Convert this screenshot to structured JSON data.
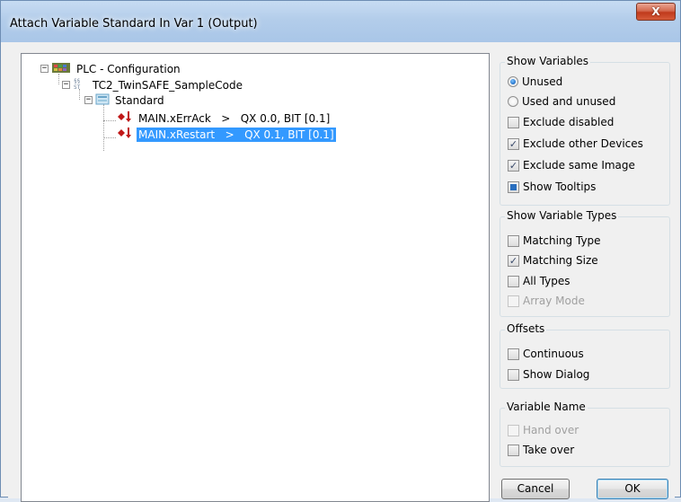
{
  "window": {
    "title": "Attach Variable Standard In Var 1 (Output)",
    "close_glyph": "X"
  },
  "tree": {
    "root": {
      "label": "PLC - Configuration",
      "icon": "plc-config-icon"
    },
    "project": {
      "label": "TC2_TwinSAFE_SampleCode",
      "icon": "plc-project-icon"
    },
    "folder": {
      "label": "Standard",
      "icon": "folder-icon"
    },
    "variables": [
      {
        "label": "MAIN.xErrAck   >   QX 0.0, BIT [0.1]",
        "icon": "output-variable-icon",
        "selected": false
      },
      {
        "label": "MAIN.xRestart   >   QX 0.1, BIT [0.1]",
        "icon": "output-variable-icon",
        "selected": true
      }
    ]
  },
  "show_variables": {
    "legend": "Show Variables",
    "unused": {
      "label": "Unused",
      "checked": true
    },
    "used_and_unused": {
      "label": "Used and unused",
      "checked": false
    },
    "exclude_disabled": {
      "label": "Exclude disabled",
      "checked": false
    },
    "exclude_other_devices": {
      "label": "Exclude other Devices",
      "checked": true
    },
    "exclude_same_image": {
      "label": "Exclude same Image",
      "checked": true
    },
    "show_tooltips": {
      "label": "Show Tooltips",
      "checked": "indeterminate"
    }
  },
  "show_variable_types": {
    "legend": "Show Variable Types",
    "matching_type": {
      "label": "Matching Type",
      "checked": false
    },
    "matching_size": {
      "label": "Matching Size",
      "checked": true
    },
    "all_types": {
      "label": "All Types",
      "checked": false
    },
    "array_mode": {
      "label": "Array Mode",
      "checked": false,
      "enabled": false
    }
  },
  "offsets": {
    "legend": "Offsets",
    "continuous": {
      "label": "Continuous",
      "checked": false
    },
    "show_dialog": {
      "label": "Show Dialog",
      "checked": false
    }
  },
  "variable_name": {
    "legend": "Variable Name",
    "hand_over": {
      "label": "Hand over",
      "checked": false,
      "enabled": false
    },
    "take_over": {
      "label": "Take over",
      "checked": false
    }
  },
  "buttons": {
    "cancel": "Cancel",
    "ok": "OK"
  },
  "check_glyph": "✓",
  "colors": {
    "selection": "#3399ff",
    "title_bar": "#b3cdea",
    "close_button": "#c0391c"
  }
}
